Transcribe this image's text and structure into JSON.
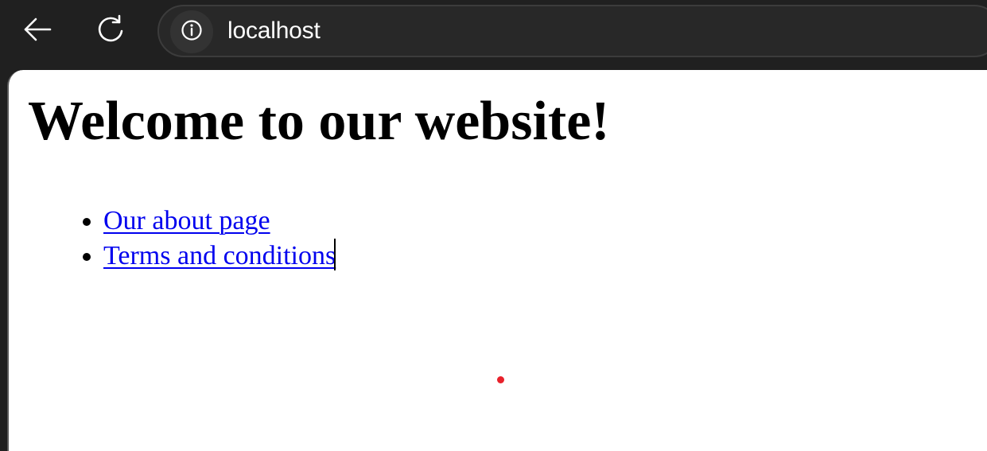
{
  "browser": {
    "toolbar": {
      "back_icon": "arrow-left-icon",
      "reload_icon": "reload-icon",
      "site_info_icon": "info-circle-icon",
      "url": "localhost"
    },
    "colors": {
      "toolbar_bg": "#202020",
      "omnibox_bg": "#282828",
      "link": "#0000ee",
      "marker": "#e8212b"
    }
  },
  "page": {
    "heading": "Welcome to our website!",
    "links": [
      {
        "label": "Our about page"
      },
      {
        "label": "Terms and conditions"
      }
    ]
  }
}
